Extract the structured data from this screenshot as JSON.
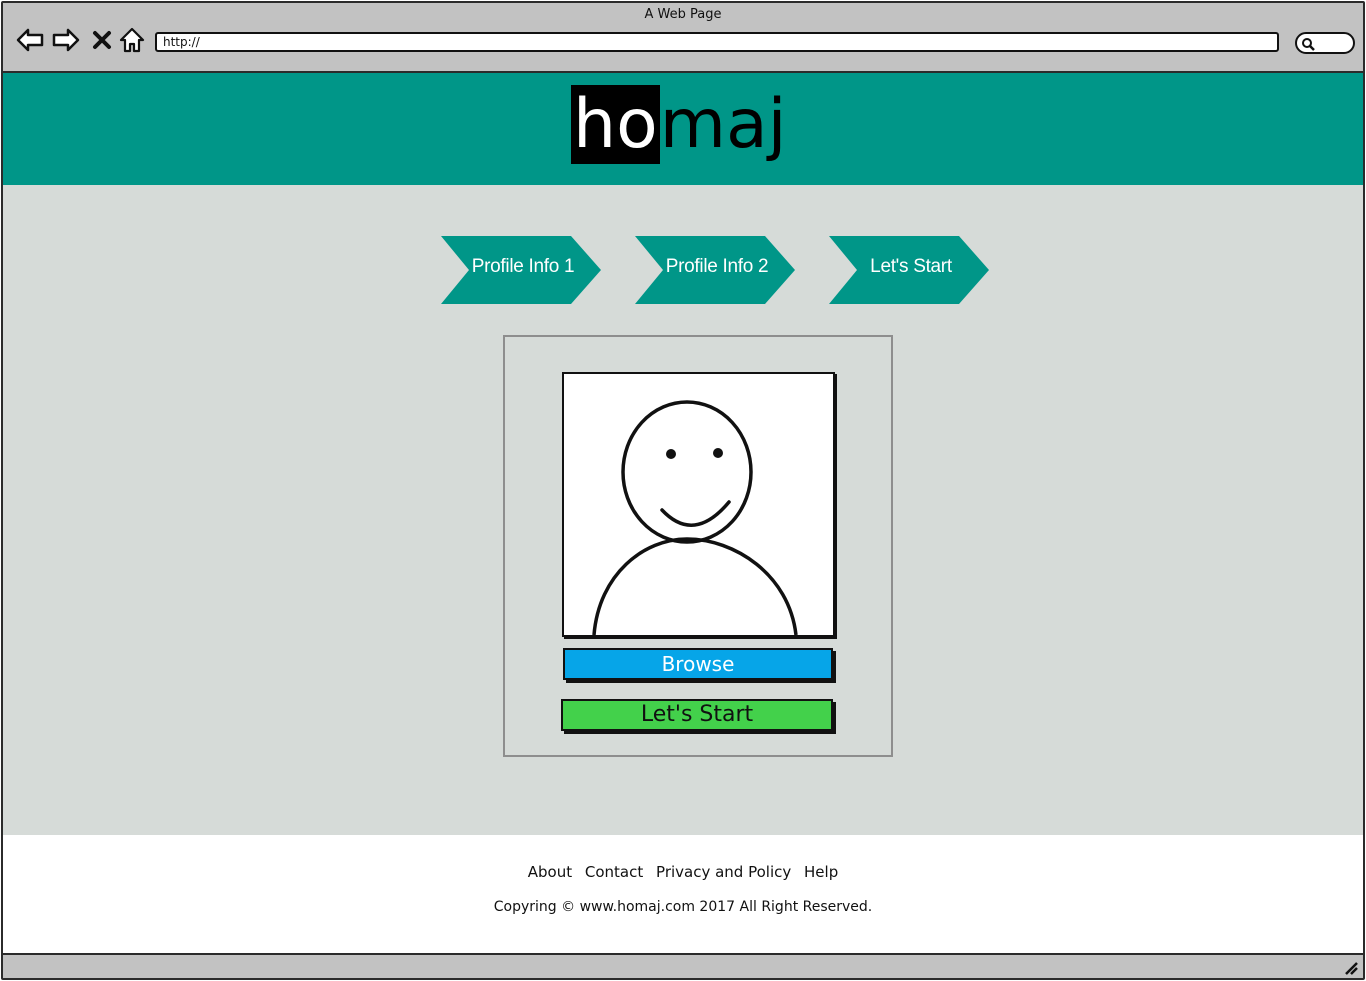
{
  "browser": {
    "window_title": "A Web Page",
    "address": "http://",
    "icons": {
      "back": "arrow-left-icon",
      "forward": "arrow-right-icon",
      "stop": "close-icon",
      "home": "home-icon",
      "search": "search-icon"
    }
  },
  "header": {
    "logo_highlight": "ho",
    "logo_rest": "maj",
    "background_color": "#009688"
  },
  "steps": [
    {
      "label": "Profile Info 1"
    },
    {
      "label": "Profile Info 2"
    },
    {
      "label": "Let's Start"
    }
  ],
  "card": {
    "avatar_icon": "user-placeholder-icon",
    "browse_label": "Browse",
    "start_label": "Let's Start",
    "browse_color": "#06a5e8",
    "start_color": "#43d14b"
  },
  "footer": {
    "links": [
      "About",
      "Contact",
      "Privacy and Policy",
      "Help"
    ],
    "copyright": "Copyring © www.homaj.com 2017 All Right Reserved."
  }
}
